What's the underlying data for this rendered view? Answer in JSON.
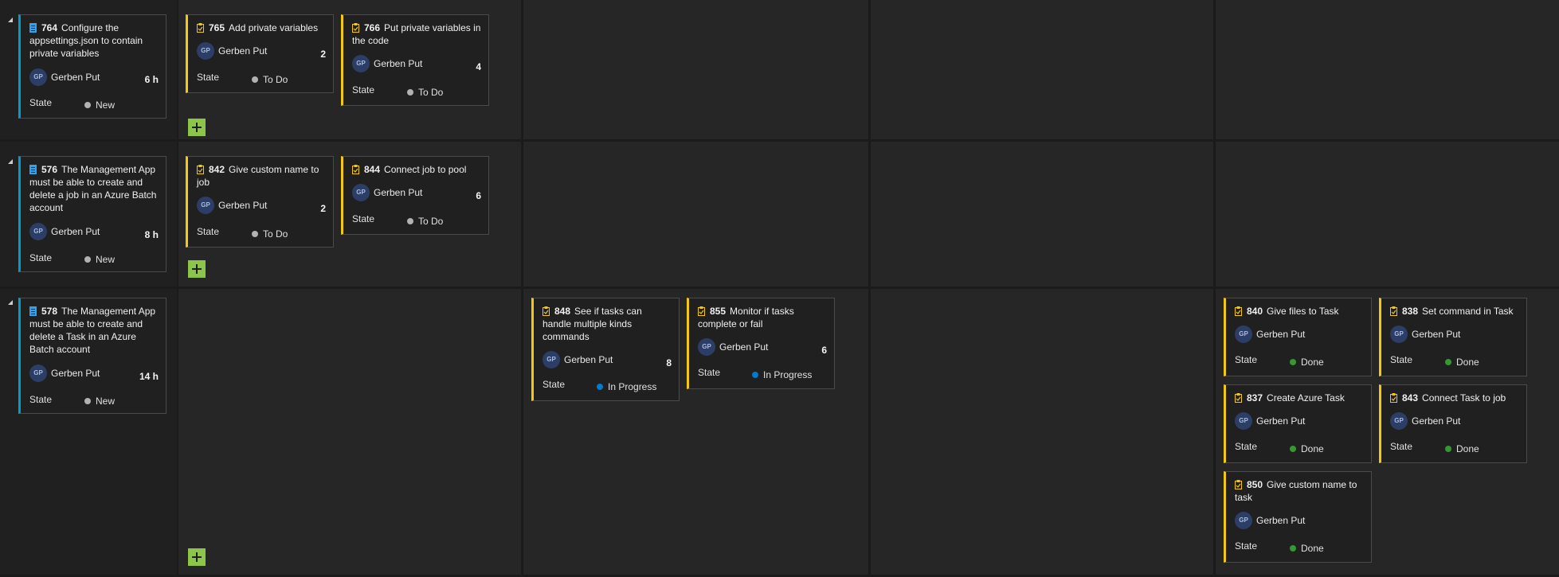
{
  "state_label": "State",
  "colors": {
    "task_bar": "#f2c811",
    "story_bar": "#009ccc",
    "new": "#b2b2b2",
    "todo": "#b2b2b2",
    "in_progress": "#007acc",
    "done": "#339933"
  },
  "rows": [
    {
      "story": {
        "id": "764",
        "title": "Configure the appsettings.json to contain private variables",
        "assignee": "Gerben Put",
        "initials": "GP",
        "effort": "6 h",
        "state": "New",
        "icon": "backlog-item-icon"
      },
      "tasks": [
        {
          "id": "765",
          "title": "Add private variables",
          "assignee": "Gerben Put",
          "initials": "GP",
          "remaining": "2",
          "state": "To Do",
          "icon": "task-icon"
        },
        {
          "id": "766",
          "title": "Put private variables in the code",
          "assignee": "Gerben Put",
          "initials": "GP",
          "remaining": "4",
          "state": "To Do",
          "icon": "task-icon"
        }
      ]
    },
    {
      "story": {
        "id": "576",
        "title": "The Management App must be able to create and delete a job in an Azure Batch account",
        "assignee": "Gerben Put",
        "initials": "GP",
        "effort": "8 h",
        "state": "New",
        "icon": "backlog-item-icon"
      },
      "tasks": [
        {
          "id": "842",
          "title": "Give custom name to job",
          "assignee": "Gerben Put",
          "initials": "GP",
          "remaining": "2",
          "state": "To Do",
          "icon": "task-icon"
        },
        {
          "id": "844",
          "title": "Connect job to pool",
          "assignee": "Gerben Put",
          "initials": "GP",
          "remaining": "6",
          "state": "To Do",
          "icon": "task-icon"
        }
      ]
    },
    {
      "story": {
        "id": "578",
        "title": "The Management App must be able to create and delete a Task in an Azure Batch account",
        "assignee": "Gerben Put",
        "initials": "GP",
        "effort": "14 h",
        "state": "New",
        "icon": "backlog-item-icon"
      },
      "tasks": [
        {
          "id": "848",
          "title": "See if tasks can handle multiple kinds commands",
          "assignee": "Gerben Put",
          "initials": "GP",
          "remaining": "8",
          "state": "In Progress",
          "icon": "task-icon"
        },
        {
          "id": "855",
          "title": "Monitor if tasks complete or fail",
          "assignee": "Gerben Put",
          "initials": "GP",
          "remaining": "6",
          "state": "In Progress",
          "icon": "task-icon"
        },
        {
          "id": "840",
          "title": "Give files to Task",
          "assignee": "Gerben Put",
          "initials": "GP",
          "state": "Done",
          "icon": "task-icon"
        },
        {
          "id": "838",
          "title": "Set command in Task",
          "assignee": "Gerben Put",
          "initials": "GP",
          "state": "Done",
          "icon": "task-icon"
        },
        {
          "id": "837",
          "title": "Create Azure Task",
          "assignee": "Gerben Put",
          "initials": "GP",
          "state": "Done",
          "icon": "task-icon"
        },
        {
          "id": "843",
          "title": "Connect Task to job",
          "assignee": "Gerben Put",
          "initials": "GP",
          "state": "Done",
          "icon": "task-icon"
        },
        {
          "id": "850",
          "title": "Give custom name to task",
          "assignee": "Gerben Put",
          "initials": "GP",
          "state": "Done",
          "icon": "task-icon"
        }
      ]
    }
  ]
}
